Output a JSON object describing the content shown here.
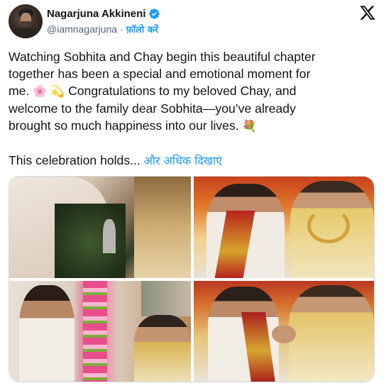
{
  "author": {
    "name": "Nagarjuna Akkineni",
    "handle": "@iamnagarjuna",
    "separator": "·",
    "follow_label": "फ़ॉलो करें",
    "verified_color": "#1d9bf0"
  },
  "tweet": {
    "line1": "Watching Sobhita and Chay begin this beautiful chapter",
    "line2": "together has been a special and emotional moment for",
    "line3_text": "me.",
    "line3_emojis": "🌸 💫",
    "line3_rest": "Congratulations to my beloved Chay, and",
    "line4": "welcome to the family dear Sobhita—you’ve already",
    "line5_text": "brought so much happiness into our lives.",
    "line5_emoji": "💐",
    "truncated_text": "This celebration holds...",
    "show_more_label": "और अधिक दिखाएं"
  },
  "media": {
    "photos": [
      "wedding-ritual-photo",
      "couple-seated-photo",
      "groom-smiling-photo",
      "couple-greeting-photo"
    ]
  },
  "icons": {
    "logo": "x-logo-icon",
    "verified": "verified-badge-icon"
  },
  "colors": {
    "link": "#1d9bf0",
    "text": "#0f1419",
    "secondary": "#536471"
  }
}
